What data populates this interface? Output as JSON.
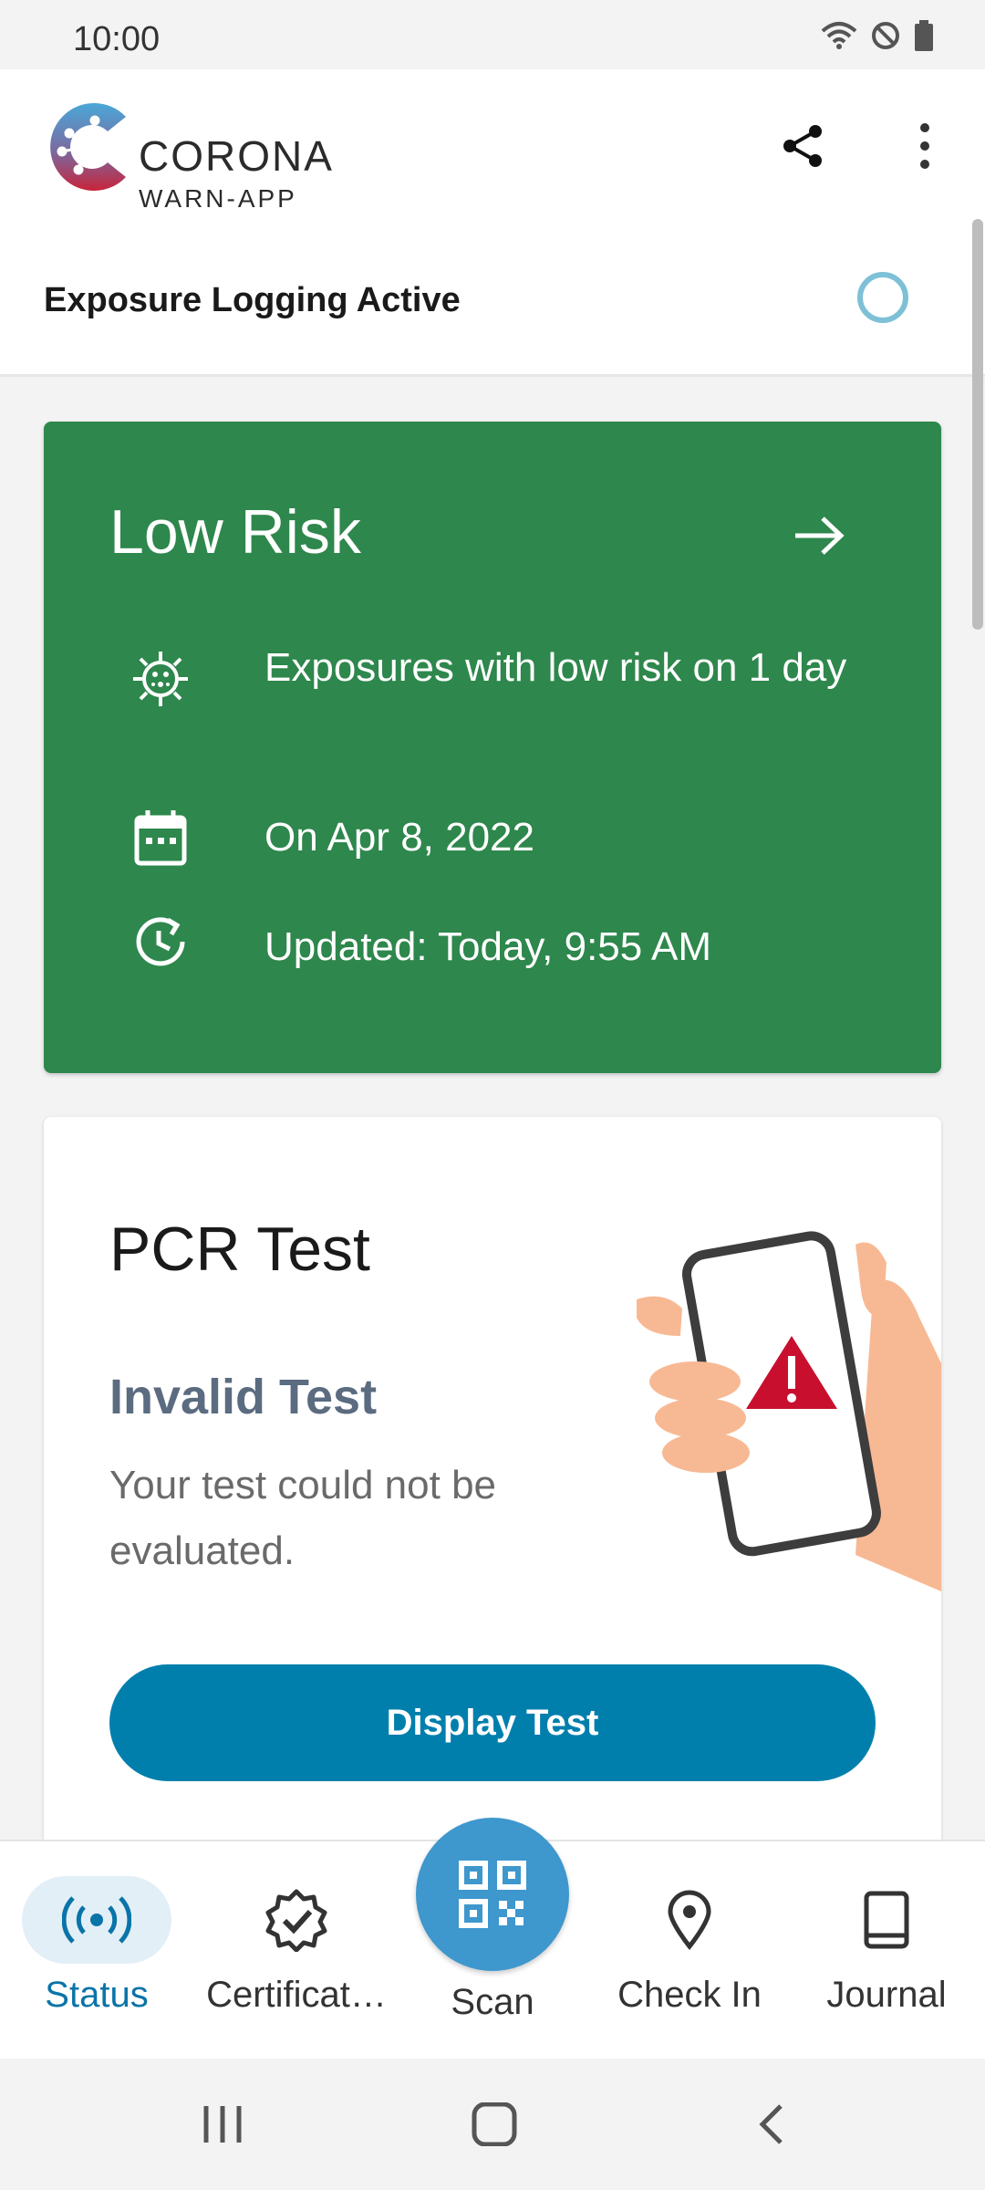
{
  "status_bar": {
    "time": "10:00"
  },
  "app": {
    "logo_line1": "CORONA",
    "logo_line2": "WARN-APP"
  },
  "header": {
    "share_icon": "share-icon",
    "more_icon": "more-vert-icon"
  },
  "exposure": {
    "label": "Exposure Logging Active"
  },
  "risk_card": {
    "title": "Low Risk",
    "color": "#2e874c",
    "rows": [
      {
        "icon": "virus-icon",
        "text": "Exposures with low risk on 1 day"
      },
      {
        "icon": "calendar-icon",
        "text": "On Apr 8, 2022"
      },
      {
        "icon": "clock-refresh-icon",
        "text": "Updated: Today, 9:55 AM"
      }
    ]
  },
  "pcr_card": {
    "title": "PCR Test",
    "subtitle": "Invalid Test",
    "description": "Your test could not be evaluated.",
    "button_label": "Display Test",
    "button_color": "#007fad"
  },
  "bottom_nav": {
    "items": [
      {
        "label": "Status",
        "icon": "broadcast-icon",
        "active": true
      },
      {
        "label": "Certificat…",
        "icon": "badge-check-icon",
        "active": false
      },
      {
        "label": "Scan",
        "icon": "qr-code-icon",
        "active": false
      },
      {
        "label": "Check In",
        "icon": "location-pin-icon",
        "active": false
      },
      {
        "label": "Journal",
        "icon": "book-icon",
        "active": false
      }
    ]
  }
}
